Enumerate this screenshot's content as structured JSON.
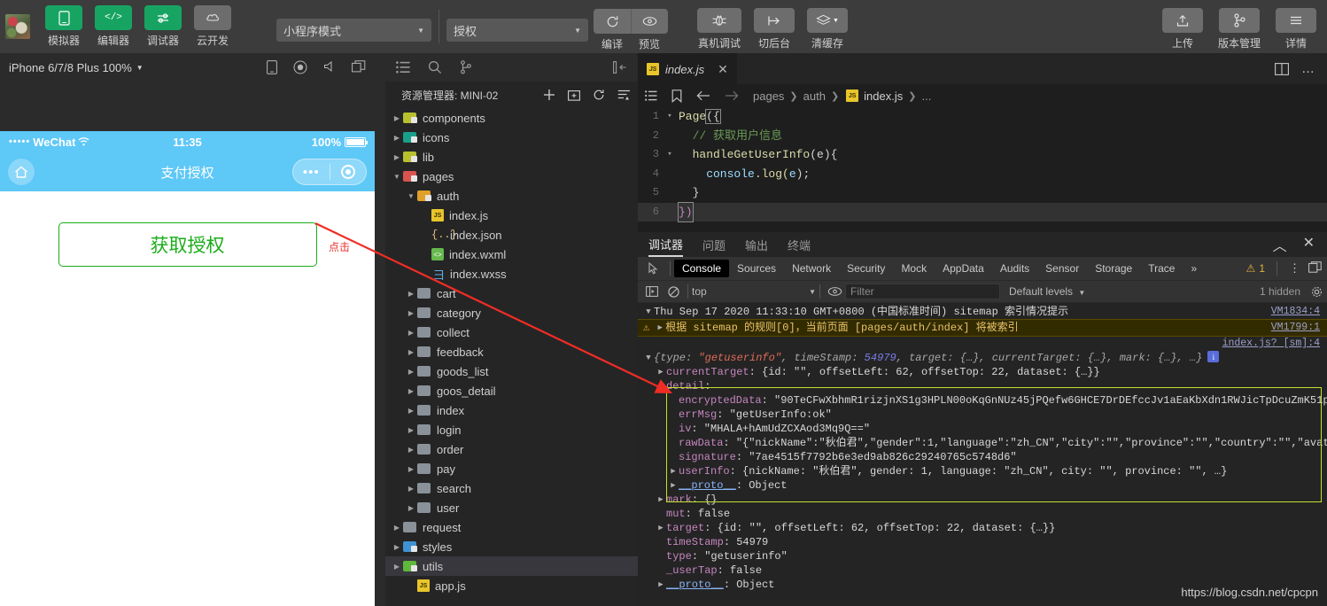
{
  "toolbar": {
    "avatar": "user-avatar",
    "buttons": [
      {
        "label": "模拟器",
        "icon": "phone-icon",
        "style": "green"
      },
      {
        "label": "编辑器",
        "icon": "code-icon",
        "style": "green"
      },
      {
        "label": "调试器",
        "icon": "sliders-icon",
        "style": "green"
      },
      {
        "label": "云开发",
        "icon": "cloud-icon",
        "style": "grey"
      }
    ],
    "mode_select": "小程序模式",
    "page_select": "授权",
    "compile_label": "编译",
    "preview_label": "预览",
    "device_debug_label": "真机调试",
    "background_label": "切后台",
    "clear_cache_label": "清缓存",
    "upload_label": "上传",
    "version_label": "版本管理",
    "details_label": "详情"
  },
  "simulator": {
    "device": "iPhone 6/7/8 Plus 100%",
    "status": {
      "dots": "•••••",
      "carrier": "WeChat",
      "time": "11:35",
      "battery": "100%"
    },
    "nav_title": "支付授权",
    "auth_button": "获取授权",
    "annotation": "点击"
  },
  "explorer": {
    "title": "资源管理器: MINI-02",
    "tree": [
      {
        "label": "components",
        "type": "folder",
        "color": "fo-yel",
        "indent": 0,
        "state": "collapsed"
      },
      {
        "label": "icons",
        "type": "folder",
        "color": "fo-teal",
        "indent": 0,
        "state": "collapsed"
      },
      {
        "label": "lib",
        "type": "folder",
        "color": "fo-yel",
        "indent": 0,
        "state": "collapsed"
      },
      {
        "label": "pages",
        "type": "folder",
        "color": "fo-red",
        "indent": 0,
        "state": "expanded"
      },
      {
        "label": "auth",
        "type": "folder",
        "color": "fo-orange",
        "indent": 1,
        "state": "expanded"
      },
      {
        "label": "index.js",
        "type": "js",
        "indent": 2,
        "state": "leaf"
      },
      {
        "label": "index.json",
        "type": "json",
        "indent": 2,
        "state": "leaf"
      },
      {
        "label": "index.wxml",
        "type": "wxml",
        "indent": 2,
        "state": "leaf"
      },
      {
        "label": "index.wxss",
        "type": "wxss",
        "indent": 2,
        "state": "leaf"
      },
      {
        "label": "cart",
        "type": "folder",
        "color": "fo-plain",
        "indent": 1,
        "state": "collapsed"
      },
      {
        "label": "category",
        "type": "folder",
        "color": "fo-plain",
        "indent": 1,
        "state": "collapsed"
      },
      {
        "label": "collect",
        "type": "folder",
        "color": "fo-plain",
        "indent": 1,
        "state": "collapsed"
      },
      {
        "label": "feedback",
        "type": "folder",
        "color": "fo-plain",
        "indent": 1,
        "state": "collapsed"
      },
      {
        "label": "goods_list",
        "type": "folder",
        "color": "fo-plain",
        "indent": 1,
        "state": "collapsed"
      },
      {
        "label": "goos_detail",
        "type": "folder",
        "color": "fo-plain",
        "indent": 1,
        "state": "collapsed"
      },
      {
        "label": "index",
        "type": "folder",
        "color": "fo-plain",
        "indent": 1,
        "state": "collapsed"
      },
      {
        "label": "login",
        "type": "folder",
        "color": "fo-plain",
        "indent": 1,
        "state": "collapsed"
      },
      {
        "label": "order",
        "type": "folder",
        "color": "fo-plain",
        "indent": 1,
        "state": "collapsed"
      },
      {
        "label": "pay",
        "type": "folder",
        "color": "fo-plain",
        "indent": 1,
        "state": "collapsed"
      },
      {
        "label": "search",
        "type": "folder",
        "color": "fo-plain",
        "indent": 1,
        "state": "collapsed"
      },
      {
        "label": "user",
        "type": "folder",
        "color": "fo-plain",
        "indent": 1,
        "state": "collapsed"
      },
      {
        "label": "request",
        "type": "folder",
        "color": "fo-plain",
        "indent": 0,
        "state": "collapsed"
      },
      {
        "label": "styles",
        "type": "folder",
        "color": "fo-blue",
        "indent": 0,
        "state": "collapsed"
      },
      {
        "label": "utils",
        "type": "folder",
        "color": "fo-green",
        "indent": 0,
        "state": "collapsed",
        "selected": true
      },
      {
        "label": "app.js",
        "type": "js",
        "indent": 1,
        "state": "leaf"
      }
    ]
  },
  "editor": {
    "tab": "index.js",
    "breadcrumb": [
      "pages",
      "auth",
      "index.js",
      "..."
    ],
    "lines": [
      {
        "n": "1",
        "fold": "▾"
      },
      {
        "n": "2",
        "fold": ""
      },
      {
        "n": "3",
        "fold": "▾"
      },
      {
        "n": "4",
        "fold": ""
      },
      {
        "n": "5",
        "fold": ""
      },
      {
        "n": "6",
        "fold": ""
      }
    ],
    "code": {
      "l1a": "Page",
      "l1b": "({",
      "l2": "  // 获取用户信息",
      "l3a": "  handleGetUserInfo",
      "l3b": "(e){",
      "l4a": "    console",
      "l4b": ".log(",
      "l4c": "e",
      "l4d": ");",
      "l5": "  }",
      "l6": "})"
    }
  },
  "debugger": {
    "panel_tabs": [
      "调试器",
      "问题",
      "输出",
      "终端"
    ],
    "active_panel_tab": "调试器",
    "devtools_tabs": [
      "Console",
      "Sources",
      "Network",
      "Security",
      "Mock",
      "AppData",
      "Audits",
      "Sensor",
      "Storage",
      "Trace"
    ],
    "active_devtools_tab": "Console",
    "overflow": "»",
    "warning_count": "1",
    "context": "top",
    "filter_placeholder": "Filter",
    "levels": "Default levels",
    "hidden": "1 hidden",
    "console": {
      "group_header": "Thu Sep 17 2020 11:33:10 GMT+0800 (中国标准时间) sitemap 索引情况提示",
      "group_source": "VM1834:4",
      "warning_text": "根据 sitemap 的规则[0]，当前页面 [pages/auth/index] 将被索引",
      "warning_source": "VM1799:1",
      "object_source": "index.js? [sm]:4",
      "event_summary": {
        "prefix": "{type: ",
        "type_value": "\"getuserinfo\"",
        "mid1": ", timeStamp: ",
        "ts_value": "54979",
        "mid2": ", target: {…}, currentTarget: {…}, mark: {…}, …}"
      },
      "rows": [
        {
          "k": "currentTarget",
          "v": ": {id: \"\", offsetLeft: 62, offsetTop: 22, dataset: {…}}",
          "exp": true,
          "indent": 1
        },
        {
          "k": "detail",
          "v": ":",
          "exp": true,
          "open": true,
          "indent": 1
        },
        {
          "k": "encryptedData",
          "v": ": \"90TeCFwXbhmR1rizjnXS1g3HPLN00oKqGnNUz45jPQefw6GHCE7DrDEfccJv1aEaKbXdn1RWJicTpDcuZmK51pHNAj…",
          "indent": 2
        },
        {
          "k": "errMsg",
          "v": ": \"getUserInfo:ok\"",
          "indent": 2
        },
        {
          "k": "iv",
          "v": ": \"MHALA+hAmUdZCXAod3Mq9Q==\"",
          "indent": 2
        },
        {
          "k": "rawData",
          "v": ": \"{\"nickName\":\"秋伯君\",\"gender\":1,\"language\":\"zh_CN\",\"city\":\"\",\"province\":\"\",\"country\":\"\",\"avatarU…",
          "indent": 2
        },
        {
          "k": "signature",
          "v": ": \"7ae4515f7792b6e3ed9ab826c29240765c5748d6\"",
          "indent": 2
        },
        {
          "k": "userInfo",
          "v": ": {nickName: \"秋伯君\", gender: 1, language: \"zh_CN\", city: \"\", province: \"\", …}",
          "exp": true,
          "indent": 2
        },
        {
          "k": "__proto__",
          "v": ": Object",
          "exp": true,
          "indent": 2
        },
        {
          "k": "mark",
          "v": ": {}",
          "exp": true,
          "indent": 1
        },
        {
          "k": "mut",
          "v": ": false",
          "indent": 1
        },
        {
          "k": "target",
          "v": ": {id: \"\", offsetLeft: 62, offsetTop: 22, dataset: {…}}",
          "exp": true,
          "indent": 1
        },
        {
          "k": "timeStamp",
          "v": ": 54979",
          "indent": 1
        },
        {
          "k": "type",
          "v": ": \"getuserinfo\"",
          "indent": 1
        },
        {
          "k": "_userTap",
          "v": ": false",
          "indent": 1
        },
        {
          "k": "__proto__",
          "v": ": Object",
          "exp": true,
          "indent": 1
        }
      ]
    }
  },
  "watermark": "https://blog.csdn.net/cpcpn"
}
